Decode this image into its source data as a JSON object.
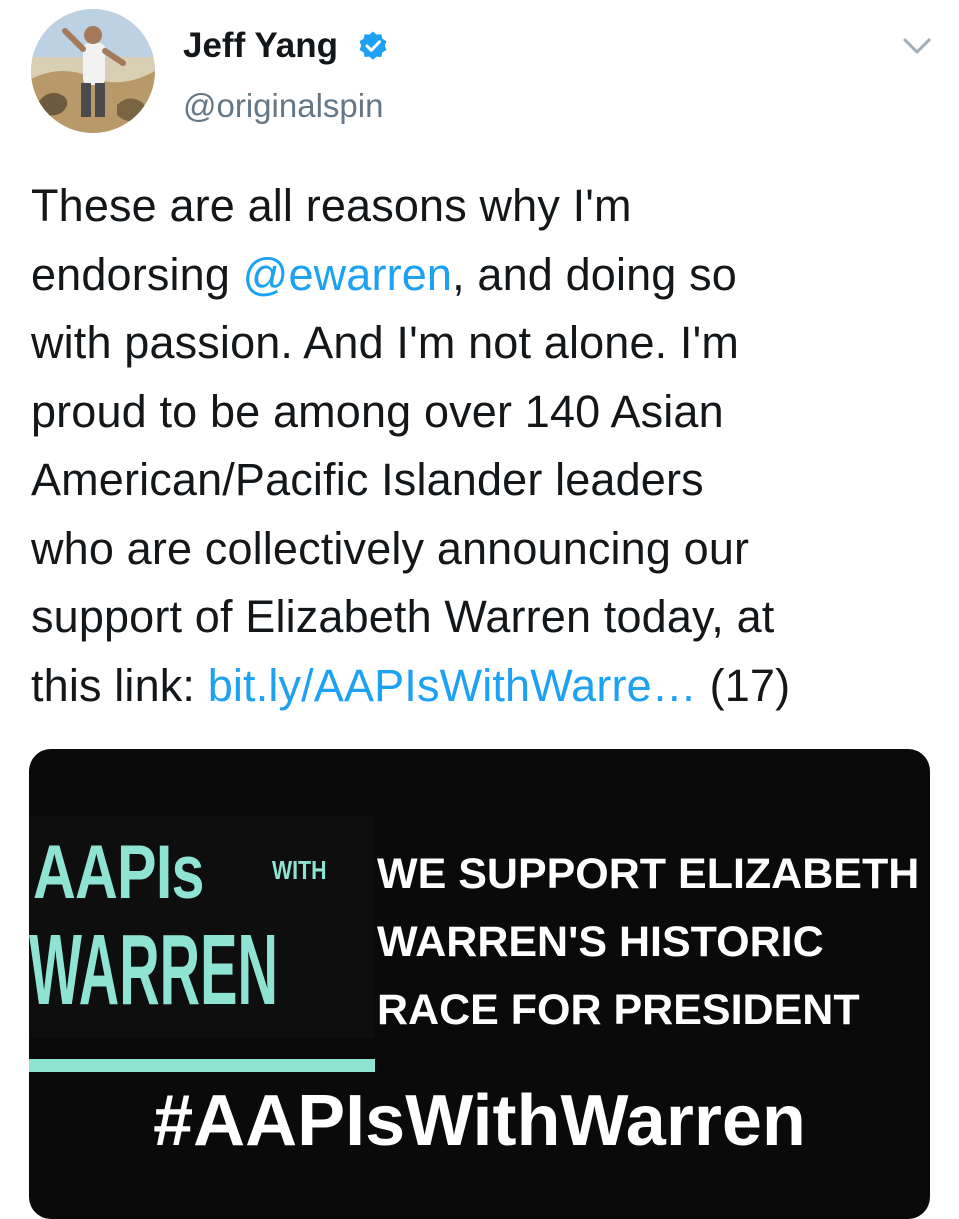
{
  "author": {
    "display_name": "Jeff Yang",
    "handle": "@originalspin",
    "verified": true
  },
  "icons": {
    "verified": "verified-badge-icon",
    "menu": "chevron-down-icon"
  },
  "tweet": {
    "lines": [
      [
        {
          "text": "These are all reasons why I'm"
        }
      ],
      [
        {
          "text": "endorsing "
        },
        {
          "text": "@ewarren",
          "link": true
        },
        {
          "text": ", and doing so"
        }
      ],
      [
        {
          "text": "with passion. And I'm not alone. I'm"
        }
      ],
      [
        {
          "text": "proud to be among over 140 Asian"
        }
      ],
      [
        {
          "text": "American/Pacific Islander leaders"
        }
      ],
      [
        {
          "text": "who are collectively announcing our"
        }
      ],
      [
        {
          "text": "support of Elizabeth Warren today, at"
        }
      ],
      [
        {
          "text": "this link: "
        },
        {
          "text": "bit.ly/AAPIsWithWarre…",
          "link": true
        },
        {
          "text": " (17)"
        }
      ]
    ]
  },
  "media": {
    "logo_line1": "AAPIs",
    "logo_with": "WITH",
    "logo_line2": "WARREN",
    "support_lines": [
      "WE SUPPORT ELIZABETH",
      "WARREN'S HISTORIC",
      "RACE FOR PRESIDENT"
    ],
    "hashtag": "#AAPIsWithWarren"
  },
  "colors": {
    "link": "#1da1f2",
    "verified": "#1da1f2",
    "handle": "#657786",
    "logo_teal": "#8ee3d2",
    "media_bg": "#0a0a0a"
  }
}
